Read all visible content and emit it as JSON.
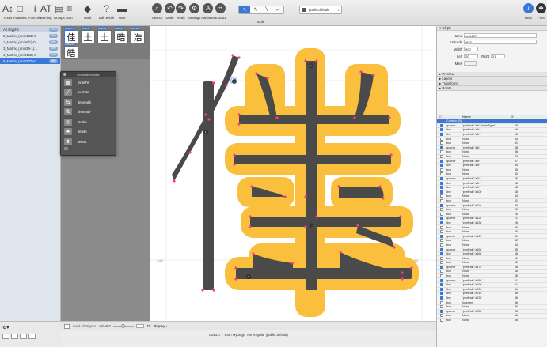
{
  "toolbar": {
    "left": [
      {
        "label": "Fonts",
        "glyph": "A↕"
      },
      {
        "label": "Features",
        "glyph": "□"
      },
      {
        "label": "Font Info",
        "glyph": "i"
      },
      {
        "label": "Kerning",
        "glyph": "AT"
      },
      {
        "label": "Groups",
        "glyph": "▤"
      },
      {
        "label": "Sort",
        "glyph": "≡"
      },
      {
        "label": "Mark",
        "glyph": "◆"
      },
      {
        "label": "Edit Width",
        "glyph": "?"
      },
      {
        "label": "Note",
        "glyph": "▬"
      }
    ],
    "right": [
      {
        "label": "Search",
        "glyph": "⌕"
      },
      {
        "label": "Undo",
        "glyph": "↶"
      },
      {
        "label": "Redo",
        "glyph": "↷"
      },
      {
        "label": "Settings",
        "glyph": "⚙"
      },
      {
        "label": "Attributes",
        "glyph": "A"
      },
      {
        "label": "Extract",
        "glyph": "⌗"
      }
    ],
    "tools_label": "Tools",
    "layer_select": "public.default",
    "help_label": "Help",
    "font_label": "Font"
  },
  "sidebar": {
    "header": "All Glyphs",
    "header_count": "1000",
    "items": [
      {
        "label": "2_Matrix_(uni5463)-0",
        "count": "999"
      },
      {
        "label": "1_Matrix_(uni2ef1)-0",
        "count": "999"
      },
      {
        "label": "3_Matrix_(uni539-1)...",
        "count": "999"
      },
      {
        "label": "4_Matrix_(uni3462)-0",
        "count": "999"
      },
      {
        "label": "5_Matrix_(uni4327)-0",
        "count": "999"
      }
    ]
  },
  "tiles": [
    {
      "char": "佳",
      "cap": "cid1427"
    },
    {
      "char": "土",
      "cap": "cid9752"
    },
    {
      "char": "土",
      "cap": "cid9753"
    },
    {
      "char": "晧",
      "cap": "cid3435"
    },
    {
      "char": "浩",
      "cap": "cid7113"
    },
    {
      "char": "皓",
      "cap": "cid6123"
    }
  ],
  "palette": {
    "title": "RoboMicroView",
    "items": [
      {
        "label": "innerFill",
        "icon": "▦"
      },
      {
        "label": "penPair",
        "icon": "╱"
      },
      {
        "label": "dependX",
        "icon": "⇆"
      },
      {
        "label": "dependY",
        "icon": "⇅"
      },
      {
        "label": "stroke",
        "icon": "◎"
      },
      {
        "label": "delete",
        "icon": "✖"
      },
      {
        "label": "select",
        "icon": "⬆"
      }
    ]
  },
  "status": {
    "load": "Load All Glyphs",
    "glyph": "cid1427",
    "unit": "Fit",
    "display": "Display"
  },
  "footer_title": "cid1427 - Yoon Myungjo 700 Regular (public.default)",
  "panel": {
    "glyph_section": "Glyph",
    "name_label": "Name",
    "name_value": "cid1427",
    "unicode_label": "Unicode",
    "unicode_value": "4f73",
    "width_label": "Width",
    "width_value": "900",
    "left_label": "Left",
    "left_value": "20",
    "right_label": "Right",
    "right_value": "21",
    "mark_label": "Mark",
    "sections": [
      "Preview",
      "Layers",
      "Transform",
      "Points"
    ],
    "table_headers": {
      "type": "Name",
      "x": "X"
    },
    "contour_label": "Contour (0)",
    "rows": [
      {
        "c": true,
        "t": "qcurve",
        "n": "'penPair':'z1r','innerType'...",
        "x": "68"
      },
      {
        "c": true,
        "t": "line",
        "n": "'penPair':'z2r'",
        "x": "66"
      },
      {
        "c": true,
        "t": "line",
        "n": "'penPair':'z3r'",
        "x": "66"
      },
      {
        "c": false,
        "t": "bcp",
        "n": "None",
        "x": "35"
      },
      {
        "c": false,
        "t": "bcp",
        "n": "None",
        "x": "31"
      },
      {
        "c": true,
        "t": "qcurve",
        "n": "'penPair':'z4r'",
        "x": "38"
      },
      {
        "c": false,
        "t": "bcp",
        "n": "None",
        "x": "36"
      },
      {
        "c": false,
        "t": "bcp",
        "n": "None",
        "x": "33"
      },
      {
        "c": true,
        "t": "qcurve",
        "n": "'penPair':'z5r'",
        "x": "37"
      },
      {
        "c": true,
        "t": "line",
        "n": "'penPair':'z6r'",
        "x": "35"
      },
      {
        "c": false,
        "t": "bcp",
        "n": "None",
        "x": "35"
      },
      {
        "c": false,
        "t": "bcp",
        "n": "None",
        "x": "32"
      },
      {
        "c": true,
        "t": "qcurve",
        "n": "'penPair':'z7r'",
        "x": "46"
      },
      {
        "c": true,
        "t": "line",
        "n": "'penPair':'z8r'",
        "x": "68"
      },
      {
        "c": true,
        "t": "line",
        "n": "'penPair':'z9r'",
        "x": "68"
      },
      {
        "c": true,
        "t": "line",
        "n": "'penPair':'z10r'",
        "x": "68"
      },
      {
        "c": false,
        "t": "bcp",
        "n": "None",
        "x": "34"
      },
      {
        "c": false,
        "t": "bcp",
        "n": "None",
        "x": "31"
      },
      {
        "c": true,
        "t": "qcurve",
        "n": "'penPair':'z11r'",
        "x": "35"
      },
      {
        "c": false,
        "t": "bcp",
        "n": "None",
        "x": "30"
      },
      {
        "c": false,
        "t": "bcp",
        "n": "None",
        "x": "26"
      },
      {
        "c": true,
        "t": "qcurve",
        "n": "'penPair':'z12r'",
        "x": "21"
      },
      {
        "c": true,
        "t": "line",
        "n": "'penPair':'z13r'",
        "x": "26"
      },
      {
        "c": false,
        "t": "bcp",
        "n": "None",
        "x": "26"
      },
      {
        "c": false,
        "t": "bcp",
        "n": "None",
        "x": "30"
      },
      {
        "c": true,
        "t": "qcurve",
        "n": "'penPair':'z14r'",
        "x": "31"
      },
      {
        "c": false,
        "t": "bcp",
        "n": "None",
        "x": "32"
      },
      {
        "c": false,
        "t": "bcp",
        "n": "None",
        "x": "34"
      },
      {
        "c": true,
        "t": "qcurve",
        "n": "'penPair':'z15r'",
        "x": "35"
      },
      {
        "c": true,
        "t": "line",
        "n": "'penPair':'z16r'",
        "x": "66"
      },
      {
        "c": false,
        "t": "bcp",
        "n": "None",
        "x": "61"
      },
      {
        "c": false,
        "t": "bcp",
        "n": "None",
        "x": "62"
      },
      {
        "c": true,
        "t": "qcurve",
        "n": "'penPair':'z17r'",
        "x": "66"
      },
      {
        "c": false,
        "t": "bcp",
        "n": "None",
        "x": "66"
      },
      {
        "c": false,
        "t": "bcp",
        "n": "None",
        "x": "66"
      },
      {
        "c": true,
        "t": "qcurve",
        "n": "'penPair':'z18r'",
        "x": "61"
      },
      {
        "c": true,
        "t": "line",
        "n": "'penPair':'z19r'",
        "x": "61"
      },
      {
        "c": true,
        "t": "line",
        "n": "'penPair':'z20r'",
        "x": "61"
      },
      {
        "c": true,
        "t": "line",
        "n": "'penPair':'z21r'",
        "x": "86"
      },
      {
        "c": true,
        "t": "line",
        "n": "'penPair':'z22r'",
        "x": "86"
      },
      {
        "c": false,
        "t": "bcp",
        "n": "inserted",
        "x": "86"
      },
      {
        "c": false,
        "t": "bcp",
        "n": "None",
        "x": "86"
      },
      {
        "c": true,
        "t": "qcurve",
        "n": "'penPair':'z23r'",
        "x": "86"
      },
      {
        "c": false,
        "t": "bcp",
        "n": "None",
        "x": "86"
      },
      {
        "c": false,
        "t": "bcp",
        "n": "None",
        "x": "86"
      }
    ]
  },
  "canvas_labels": {
    "left_metric": "0-0.0",
    "right_metric": "0-0.0"
  },
  "colors": {
    "glyph": "#4a4a4a",
    "stroke_fill": "#fbbf3e",
    "point": "#ff3a8e",
    "selection": "#3a78d8"
  }
}
